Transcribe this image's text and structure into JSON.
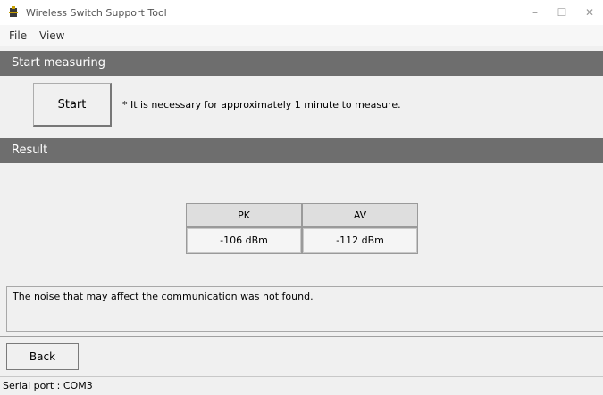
{
  "window": {
    "title": "Wireless Switch Support Tool",
    "controls": {
      "minimize": "–",
      "maximize": "☐",
      "close": "✕"
    }
  },
  "menu": {
    "items": [
      "File",
      "View"
    ]
  },
  "start_section": {
    "header": "Start measuring",
    "start_label": "Start",
    "note": "* It is necessary for approximately 1 minute to measure."
  },
  "result_section": {
    "header": "Result",
    "table": {
      "columns": [
        "PK",
        "AV"
      ],
      "values": [
        "-106 dBm",
        "-112 dBm"
      ]
    },
    "message": "The noise that may affect the communication was not found."
  },
  "footer": {
    "back_label": "Back",
    "serial_port": "Serial port :  COM3"
  }
}
